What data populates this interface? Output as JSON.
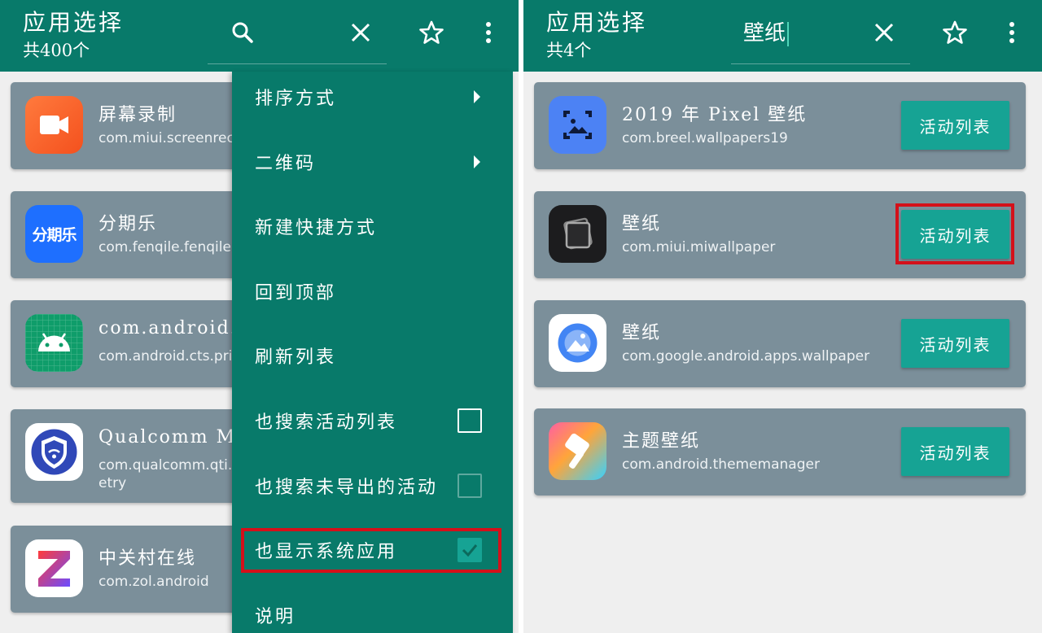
{
  "left": {
    "title": "应用选择",
    "count": "共400个",
    "apps": [
      {
        "name": "屏幕录制",
        "package": "com.miui.screenrec"
      },
      {
        "name": "分期乐",
        "package": "com.fenqile.fenqile",
        "icon_text": "分期乐"
      },
      {
        "name": "com.android.cts.",
        "package": "com.android.cts.pri"
      },
      {
        "name": "Qualcomm Mob",
        "package": "com.qualcomm.qti.",
        "package_line2": "etry"
      },
      {
        "name": "中关村在线",
        "package": "com.zol.android"
      }
    ],
    "menu": {
      "items": [
        {
          "label": "排序方式"
        },
        {
          "label": "二维码"
        },
        {
          "label": "新建快捷方式"
        },
        {
          "label": "回到顶部"
        },
        {
          "label": "刷新列表"
        },
        {
          "label": "也搜索活动列表",
          "checked": false
        },
        {
          "label": "也搜索未导出的活动",
          "checked": false,
          "disabled": true
        },
        {
          "label": "也显示系统应用",
          "checked": true
        },
        {
          "label": "说明"
        }
      ]
    }
  },
  "right": {
    "title": "应用选择",
    "count": "共4个",
    "search_query": "壁纸",
    "apps": [
      {
        "name": "2019 年 Pixel 壁纸",
        "package": "com.breel.wallpapers19",
        "button": "活动列表"
      },
      {
        "name": "壁纸",
        "package": "com.miui.miwallpaper",
        "button": "活动列表"
      },
      {
        "name": "壁纸",
        "package": "com.google.android.apps.wallpaper",
        "button": "活动列表"
      },
      {
        "name": "主题壁纸",
        "package": "com.android.thememanager",
        "button": "活动列表"
      }
    ]
  },
  "colors": {
    "toolbar": "#087a6a",
    "card": "#7b8f9a",
    "accent_button": "#16a394",
    "highlight": "#d4101a"
  },
  "icons": [
    "search-icon",
    "close-icon",
    "star-icon",
    "more-vert-icon",
    "check-icon",
    "submenu-arrow-icon"
  ]
}
